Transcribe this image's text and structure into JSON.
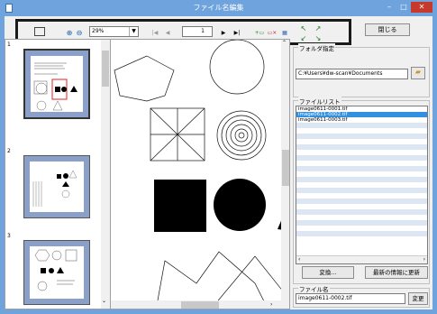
{
  "window": {
    "title": "ファイル名編集",
    "minimize": "–",
    "maximize": "□",
    "close": "✕"
  },
  "toolbar": {
    "zoom_value": "29%",
    "page_value": "1",
    "first_page": "|◀",
    "prev_page": "◀",
    "next_page": "▶",
    "last_page": "▶|",
    "close_label": "閉じる"
  },
  "thumbnails": [
    {
      "label": "1",
      "selected": true
    },
    {
      "label": "2",
      "selected": false
    },
    {
      "label": "3",
      "selected": false
    }
  ],
  "folder": {
    "group_label": "フォルダ指定",
    "path": "C:¥Users¥dw-scan¥Documents"
  },
  "filelist": {
    "group_label": "ファイルリスト",
    "items": [
      "image0611-0001.tif",
      "image0611-0002.tif",
      "image0611-0003.tif"
    ],
    "selected_index": 1
  },
  "actions": {
    "convert_label": "変換...",
    "refresh_label": "最新の情報に更新"
  },
  "filename": {
    "group_label": "ファイル名",
    "value": "image0611-0002.tif",
    "change_label": "変更"
  },
  "colors": {
    "titlebar": "#6fa3dd",
    "selection": "#3390e0",
    "thumb_bg": "#8aa0c8"
  }
}
